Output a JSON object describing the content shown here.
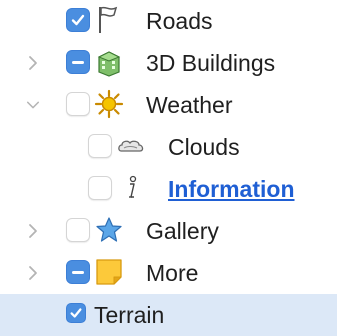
{
  "tree": {
    "items": [
      {
        "label": "Roads",
        "state": "checked",
        "icon": "flag-icon",
        "indent": 0,
        "expander": "none"
      },
      {
        "label": "3D Buildings",
        "state": "mixed",
        "icon": "building-icon",
        "indent": 0,
        "expander": "collapsed"
      },
      {
        "label": "Weather",
        "state": "unchecked",
        "icon": "sun-icon",
        "indent": 0,
        "expander": "expanded"
      },
      {
        "label": "Clouds",
        "state": "unchecked",
        "icon": "cloud-icon",
        "indent": 1,
        "expander": "none"
      },
      {
        "label": "Information",
        "state": "unchecked",
        "icon": "info-icon",
        "indent": 1,
        "expander": "none",
        "link": true
      },
      {
        "label": "Gallery",
        "state": "unchecked",
        "icon": "star-icon",
        "indent": 0,
        "expander": "collapsed"
      },
      {
        "label": "More",
        "state": "mixed",
        "icon": "folder-icon",
        "indent": 0,
        "expander": "collapsed"
      },
      {
        "label": "Terrain",
        "state": "checked",
        "icon": "none",
        "indent": 0,
        "expander": "none",
        "selected": true
      }
    ]
  },
  "colors": {
    "checkbox_blue": "#4a8ee0",
    "selection_highlight": "#dce8f7",
    "link_blue": "#1f5fd4"
  }
}
